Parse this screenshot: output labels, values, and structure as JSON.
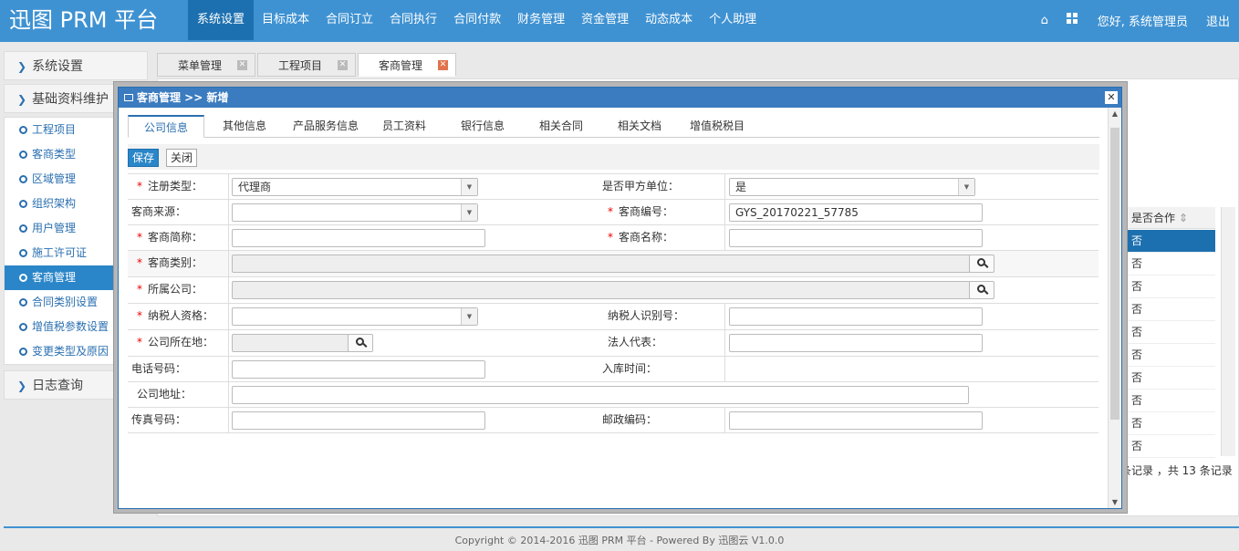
{
  "app": {
    "logo": "迅图 PRM 平台"
  },
  "nav": {
    "items": [
      "系统设置",
      "目标成本",
      "合同订立",
      "合同执行",
      "合同付款",
      "财务管理",
      "资金管理",
      "动态成本",
      "个人助理"
    ],
    "greeting": "您好, 系统管理员",
    "logout": "退出"
  },
  "sidebar": {
    "section1": "系统设置",
    "section2": "基础资料维护",
    "items": [
      "工程项目",
      "客商类型",
      "区域管理",
      "组织架构",
      "用户管理",
      "施工许可证",
      "客商管理",
      "合同类别设置",
      "增值税参数设置",
      "变更类型及原因"
    ],
    "section3": "日志查询"
  },
  "tabs": [
    "菜单管理",
    "工程项目",
    "客商管理"
  ],
  "background_table": {
    "header": "是否合作",
    "rows": [
      "否",
      "否",
      "否",
      "否",
      "否",
      "否",
      "否",
      "否",
      "否",
      "否"
    ],
    "footer": "条记录 ，共 13 条记录"
  },
  "modal": {
    "title": "客商管理 >> 新增",
    "tabs": [
      "公司信息",
      "其他信息",
      "产品服务信息",
      "员工资料",
      "银行信息",
      "相关合同",
      "相关文档",
      "增值税税目"
    ],
    "save": "保存",
    "close": "关闭",
    "form": {
      "reg_type_label": "注册类型：",
      "reg_type_value": "代理商",
      "is_party_a_label": "是否甲方单位：",
      "is_party_a_value": "是",
      "source_label": "客商来源：",
      "code_label": "客商编号：",
      "code_value": "GYS_20170221_57785",
      "short_name_label": "客商简称：",
      "name_label": "客商名称：",
      "category_label": "客商类别：",
      "company_label": "所属公司：",
      "taxpayer_label": "纳税人资格：",
      "tax_id_label": "纳税人识别号：",
      "location_label": "公司所在地：",
      "legal_label": "法人代表：",
      "phone_label": "电话号码：",
      "stock_time_label": "入库时间：",
      "address_label": "公司地址：",
      "fax_label": "传真号码：",
      "postal_label": "邮政编码："
    }
  },
  "footer": {
    "copyright": "Copyright © 2014-2016 迅图 PRM 平台 - Powered By 迅图云 V1.0.0"
  }
}
